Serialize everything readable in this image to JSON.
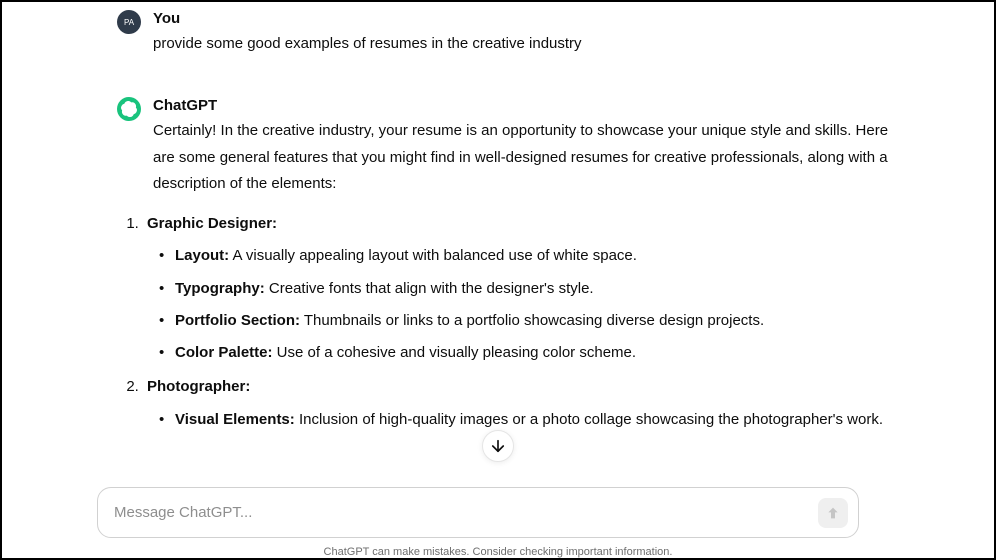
{
  "user": {
    "avatar_initials": "PA",
    "author": "You",
    "message": "provide some good examples of resumes in the creative industry"
  },
  "assistant": {
    "author": "ChatGPT",
    "intro": "Certainly! In the creative industry, your resume is an opportunity to showcase your unique style and skills. Here are some general features that you might find in well-designed resumes for creative professionals, along with a description of the elements:",
    "list": [
      {
        "heading": "Graphic Designer:",
        "items": [
          {
            "label": "Layout:",
            "text": " A visually appealing layout with balanced use of white space."
          },
          {
            "label": "Typography:",
            "text": " Creative fonts that align with the designer's style."
          },
          {
            "label": "Portfolio Section:",
            "text": " Thumbnails or links to a portfolio showcasing diverse design projects."
          },
          {
            "label": "Color Palette:",
            "text": " Use of a cohesive and visually pleasing color scheme."
          }
        ]
      },
      {
        "heading": "Photographer:",
        "items": [
          {
            "label": "Visual Elements:",
            "text": " Inclusion of high-quality images or a photo collage showcasing the photographer's work."
          }
        ]
      }
    ]
  },
  "input": {
    "placeholder": "Message ChatGPT..."
  },
  "footer": "ChatGPT can make mistakes. Consider checking important information."
}
